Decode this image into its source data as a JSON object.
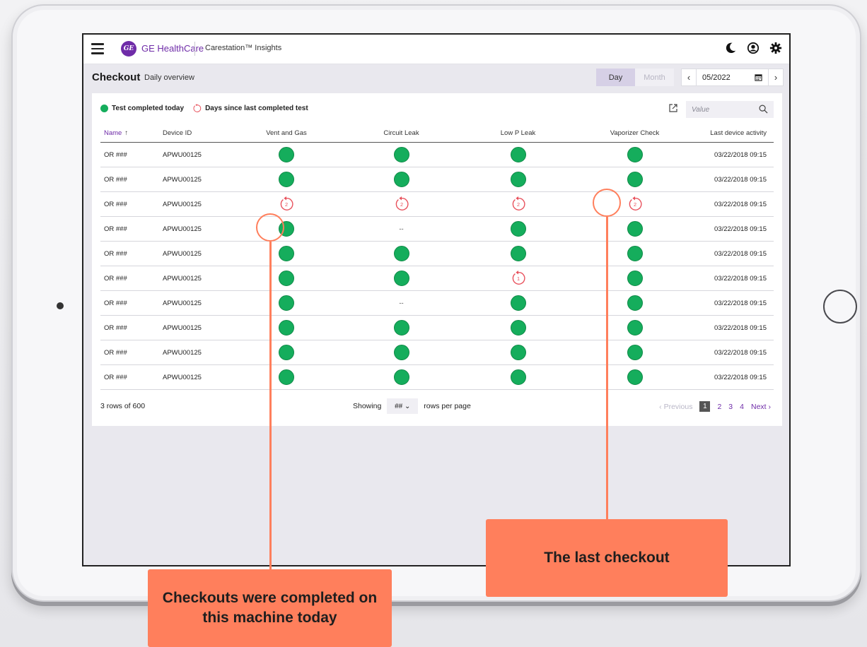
{
  "header": {
    "brand": "GE HealthCare",
    "logo_text": "GE",
    "app_title": "Carestation™ Insights"
  },
  "subheader": {
    "title": "Checkout",
    "subtitle": "Daily overview",
    "segment_day": "Day",
    "segment_month": "Month",
    "date": "05/2022"
  },
  "legend": {
    "completed": "Test completed today",
    "days_since": "Days since last completed test"
  },
  "search": {
    "placeholder": "Value"
  },
  "table": {
    "columns": [
      "Name",
      "Device ID",
      "Vent and Gas",
      "Circuit Leak",
      "Low P Leak",
      "Vaporizer Check",
      "Last device activity"
    ],
    "rows": [
      {
        "name": "OR ###",
        "device": "APWU00125",
        "activity": "03/22/2018  09:15"
      },
      {
        "name": "OR ###",
        "device": "APWU00125",
        "activity": "03/22/2018  09:15"
      },
      {
        "name": "OR ###",
        "device": "APWU00125",
        "activity": "03/22/2018  09:15"
      },
      {
        "name": "OR ###",
        "device": "APWU00125",
        "activity": "03/22/2018  09:15"
      },
      {
        "name": "OR ###",
        "device": "APWU00125",
        "activity": "03/22/2018  09:15"
      },
      {
        "name": "OR ###",
        "device": "APWU00125",
        "activity": "03/22/2018  09:15"
      },
      {
        "name": "OR ###",
        "device": "APWU00125",
        "activity": "03/22/2018  09:15"
      },
      {
        "name": "OR ###",
        "device": "APWU00125",
        "activity": "03/22/2018  09:15"
      },
      {
        "name": "OR ###",
        "device": "APWU00125",
        "activity": "03/22/2018  09:15"
      },
      {
        "name": "OR ###",
        "device": "APWU00125",
        "activity": "03/22/2018  09:15"
      }
    ],
    "dash": "--",
    "retry_days": [
      "2",
      "1"
    ]
  },
  "footer": {
    "row_count": "3 rows of 600",
    "showing": "Showing",
    "per_page_value": "##",
    "rows_per_page": "rows per page",
    "previous": "Previous",
    "pages": [
      "1",
      "2",
      "3",
      "4"
    ],
    "next": "Next"
  },
  "callouts": {
    "left": "Checkouts were completed on this machine today",
    "right": "The last checkout"
  },
  "colors": {
    "accent": "#6f2ca8",
    "completed": "#15ad5c",
    "days_since": "#e8505b",
    "callout": "#ff7f5c"
  }
}
